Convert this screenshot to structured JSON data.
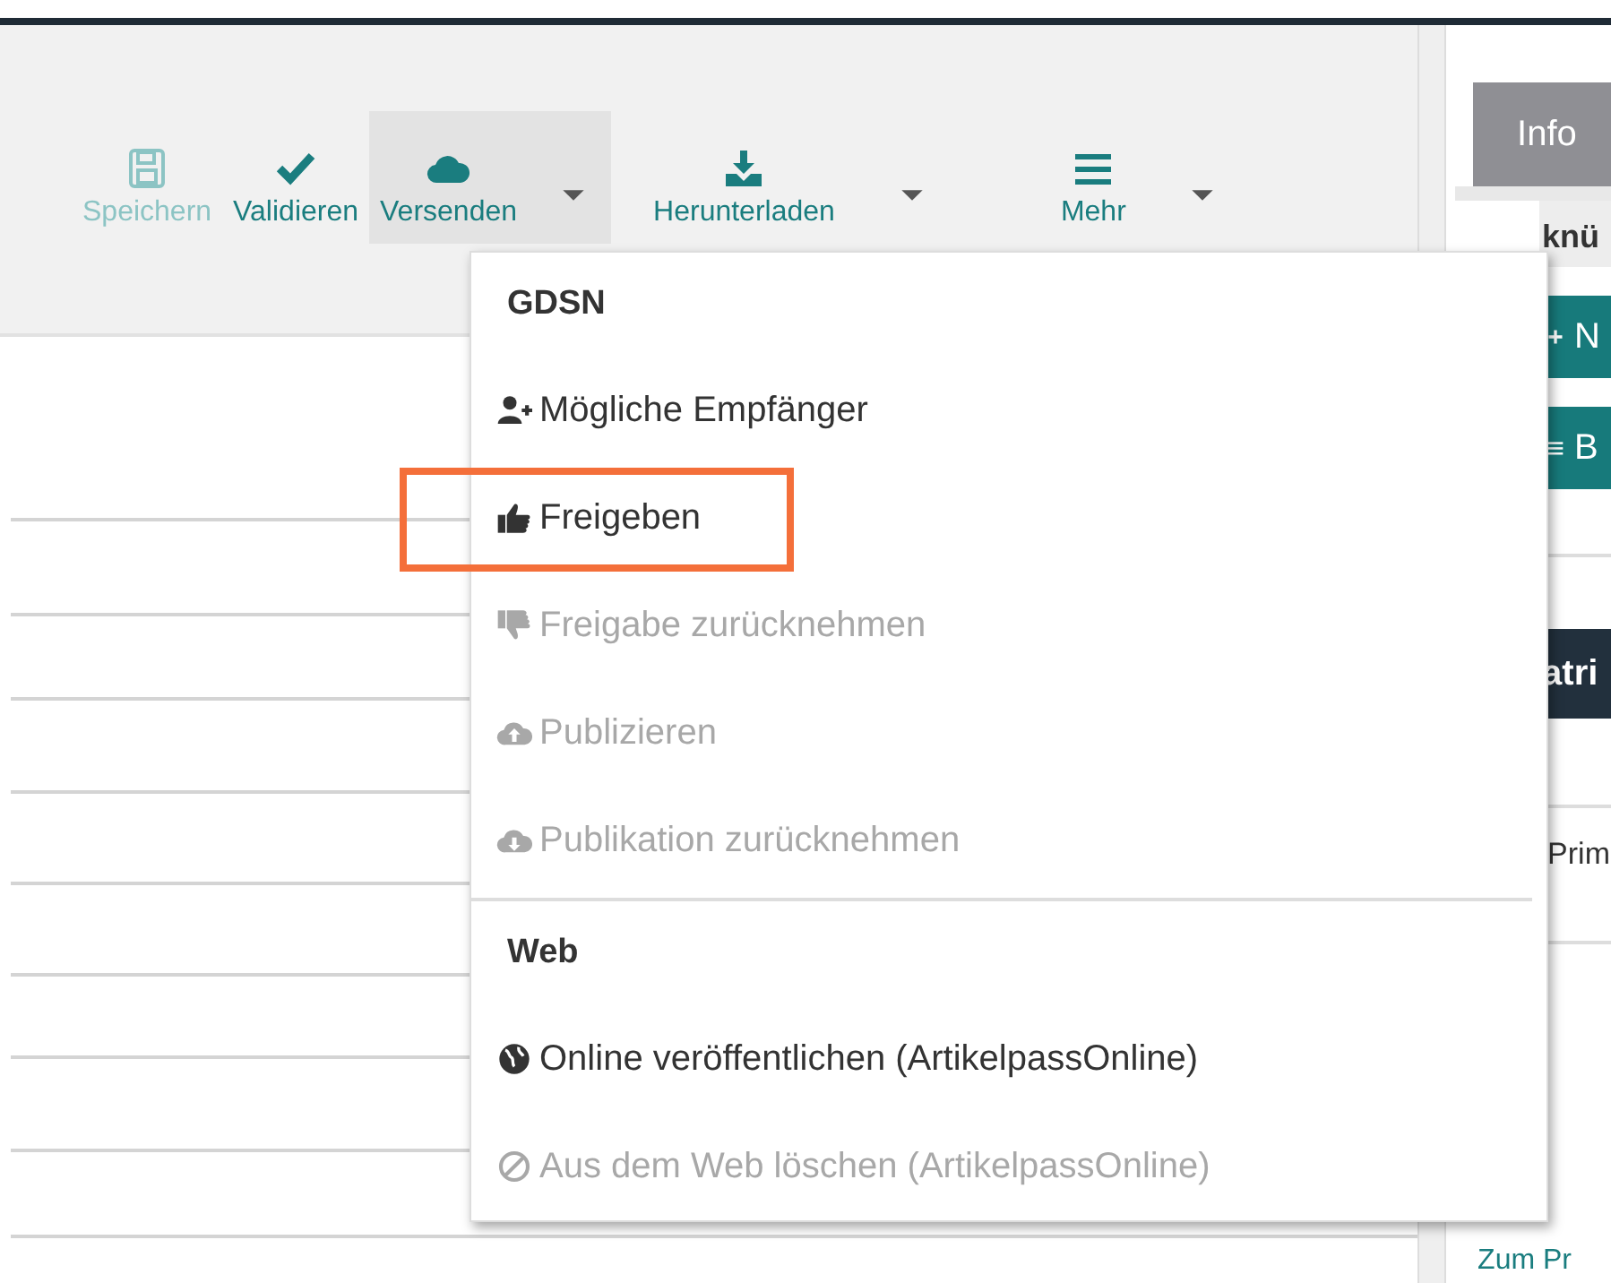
{
  "toolbar": {
    "buttons": [
      {
        "label": "Speichern",
        "disabled": true,
        "open": false,
        "has_menu": false
      },
      {
        "label": "Validieren",
        "disabled": false,
        "open": false,
        "has_menu": false
      },
      {
        "label": "Versenden",
        "disabled": false,
        "open": true,
        "has_menu": true
      },
      {
        "label": "Herunterladen",
        "disabled": false,
        "open": false,
        "has_menu": true
      },
      {
        "label": "Mehr",
        "disabled": false,
        "open": false,
        "has_menu": true
      }
    ]
  },
  "menu": {
    "items": [
      {
        "kind": "header",
        "label": "GDSN"
      },
      {
        "kind": "item",
        "label": "Mögliche Empfänger",
        "disabled": false,
        "highlighted": false
      },
      {
        "kind": "item",
        "label": "Freigeben",
        "disabled": false,
        "highlighted": true
      },
      {
        "kind": "item",
        "label": "Freigabe zurücknehmen",
        "disabled": true,
        "highlighted": false
      },
      {
        "kind": "item",
        "label": "Publizieren",
        "disabled": true,
        "highlighted": false
      },
      {
        "kind": "item",
        "label": "Publikation zurücknehmen",
        "disabled": true,
        "highlighted": false
      },
      {
        "kind": "separator"
      },
      {
        "kind": "header",
        "label": "Web"
      },
      {
        "kind": "item",
        "label": "Online veröffentlichen (ArtikelpassOnline)",
        "disabled": false,
        "highlighted": false
      },
      {
        "kind": "item",
        "label": "Aus dem Web löschen (ArtikelpassOnline)",
        "disabled": true,
        "highlighted": false
      }
    ]
  },
  "side_panel": {
    "tab": {
      "label": "Info",
      "selected": true
    },
    "section_title": "knü",
    "buttons": [
      {
        "label": "N"
      },
      {
        "label": "B"
      }
    ],
    "dark_header": "atri",
    "row_text": "Prim",
    "link": "Zum Pr"
  }
}
